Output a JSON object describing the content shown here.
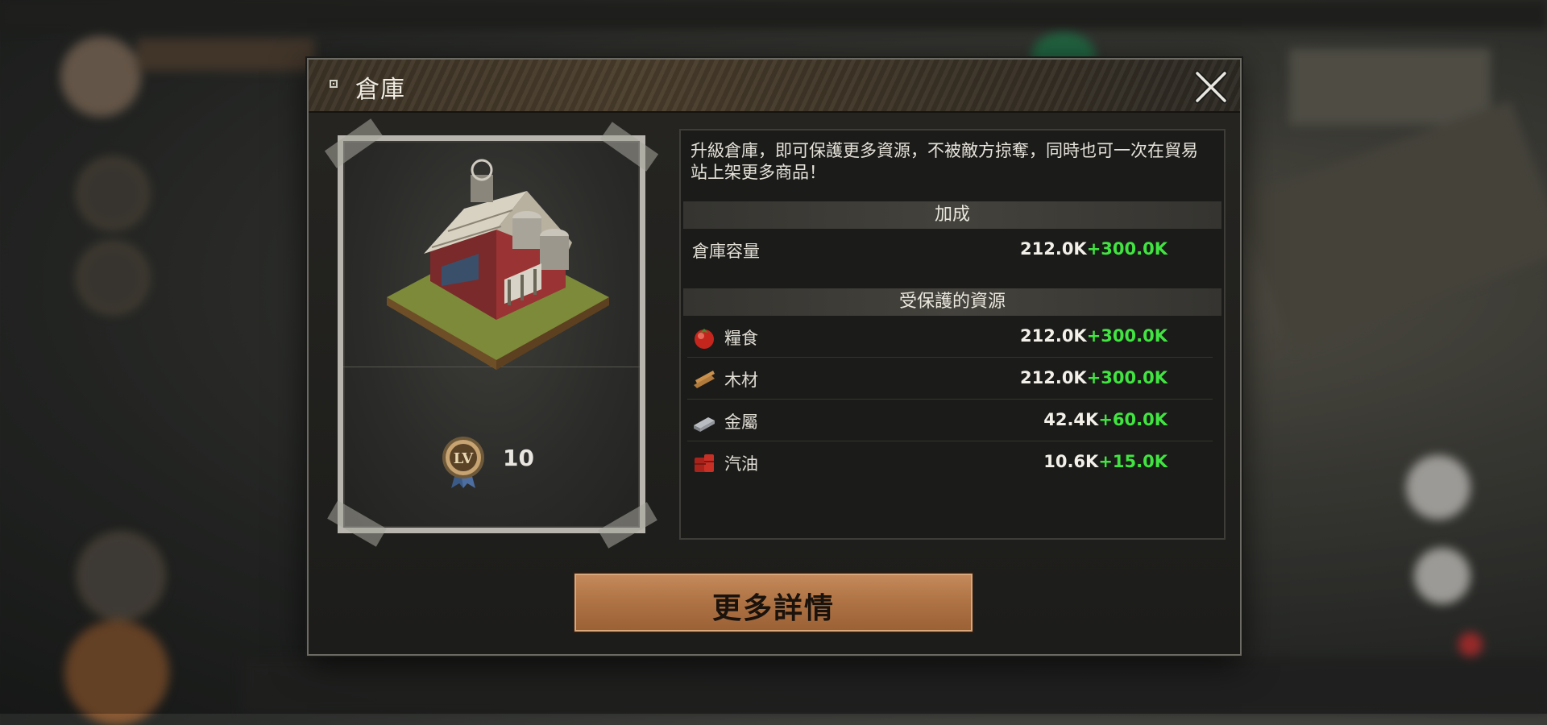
{
  "dialog": {
    "title": "倉庫",
    "close_icon": "close-x-icon"
  },
  "building": {
    "name": "warehouse",
    "level_badge_text": "LV",
    "level": "10"
  },
  "info": {
    "description": "升級倉庫，即可保護更多資源，不被敵方掠奪，同時也可一次在貿易站上架更多商品！",
    "bonus_section": {
      "header": "加成",
      "rows": [
        {
          "label": "倉庫容量",
          "base": "212.0K",
          "bonus": "+300.0K"
        }
      ]
    },
    "protected_section": {
      "header": "受保護的資源",
      "rows": [
        {
          "icon": "food-tomato-icon",
          "label": "糧食",
          "base": "212.0K",
          "bonus": "+300.0K"
        },
        {
          "icon": "wood-planks-icon",
          "label": "木材",
          "base": "212.0K",
          "bonus": "+300.0K"
        },
        {
          "icon": "metal-ingot-icon",
          "label": "金屬",
          "base": "42.4K",
          "bonus": "+60.0K"
        },
        {
          "icon": "oil-barrel-icon",
          "label": "汽油",
          "base": "10.6K",
          "bonus": "+15.0K"
        }
      ]
    }
  },
  "actions": {
    "more_details_label": "更多詳情"
  },
  "colors": {
    "bonus_green": "#41e441",
    "button_copper": "#b07445",
    "header_rust": "#4b3e2c"
  }
}
